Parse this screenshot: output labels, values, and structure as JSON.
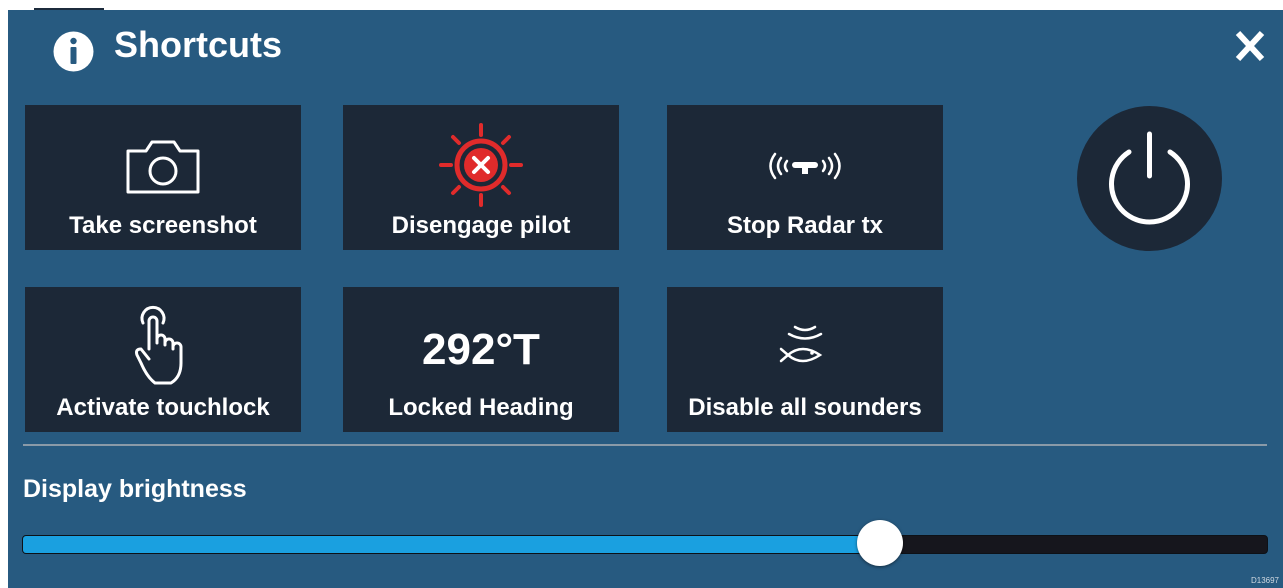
{
  "header": {
    "title": "Shortcuts",
    "info_icon": "info-icon",
    "close_label": "X"
  },
  "shortcuts": [
    {
      "label": "Take screenshot",
      "icon": "camera-icon"
    },
    {
      "label": "Disengage pilot",
      "icon": "disengage-pilot-icon"
    },
    {
      "label": "Stop Radar tx",
      "icon": "radar-icon"
    },
    {
      "label": "Activate touchlock",
      "icon": "touch-hand-icon"
    },
    {
      "label": "Locked Heading",
      "value": "292°T"
    },
    {
      "label": "Disable all sounders",
      "icon": "sounder-fish-icon"
    }
  ],
  "power": {
    "icon": "power-icon"
  },
  "brightness": {
    "label": "Display brightness",
    "level_fraction": 0.69
  },
  "ref_code": "D13697",
  "colors": {
    "panel": "#275a80",
    "tile": "#1c2837",
    "accent": "#1aa0e0",
    "alert": "#e02b2b",
    "text": "#ffffff"
  }
}
